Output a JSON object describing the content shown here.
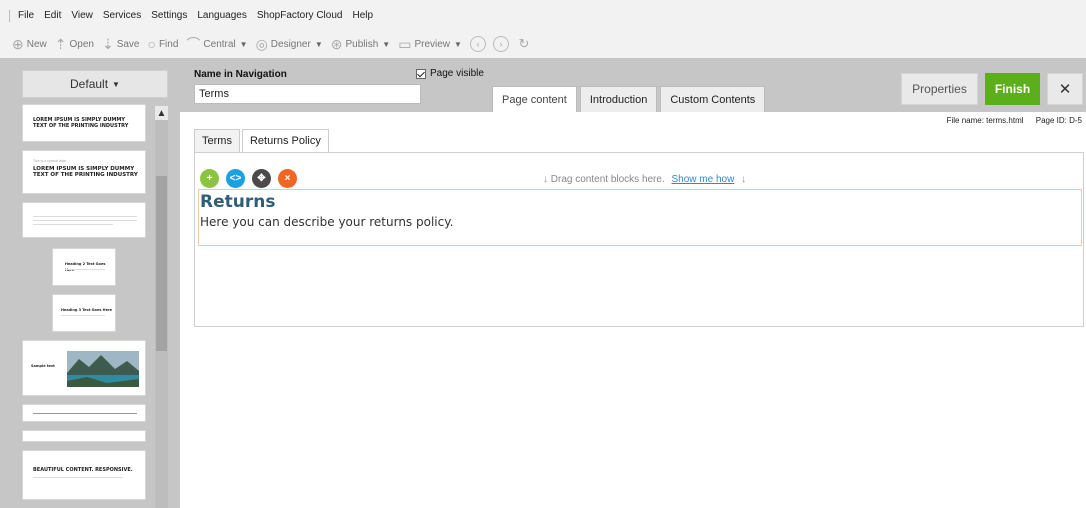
{
  "menu": [
    "File",
    "Edit",
    "View",
    "Services",
    "Settings",
    "Languages",
    "ShopFactory Cloud",
    "Help"
  ],
  "toolbar": {
    "new": "New",
    "open": "Open",
    "save": "Save",
    "find": "Find",
    "central": "Central",
    "designer": "Designer",
    "publish": "Publish",
    "preview": "Preview"
  },
  "left_panel": {
    "default_label": "Default",
    "thumbs": [
      {
        "title": "LOREM IPSUM IS SIMPLY DUMMY TEXT OF THE PRINTING INDUSTRY"
      },
      {
        "small": "This is a special label",
        "title": "LOREM IPSUM IS SIMPLY DUMMY TEXT OF THE PRINTING INDUSTRY"
      },
      {
        "title": ""
      },
      {
        "title": "Heading 2 Text Goes Here"
      },
      {
        "title": "Heading 3 Text Goes Here"
      },
      {
        "title": "Sample text"
      },
      {
        "title": ""
      },
      {
        "title": ""
      },
      {
        "title": "BEAUTIFUL CONTENT. RESPONSIVE."
      }
    ]
  },
  "header": {
    "nav_label": "Name in Navigation",
    "nav_value": "Terms",
    "page_visible": "Page visible",
    "tabs": [
      "Page content",
      "Introduction",
      "Custom Contents"
    ],
    "properties": "Properties",
    "finish": "Finish",
    "close": "✕"
  },
  "main": {
    "file_name": "File name: terms.html",
    "page_id": "Page ID: D-5",
    "subtabs": [
      "Terms",
      "Returns Policy"
    ],
    "drag_hint": "Drag content blocks here.",
    "show_me_how": "Show me how",
    "block_title": "Returns",
    "block_text": "Here you can describe your returns policy."
  },
  "colors": {
    "finish": "#5caf1c",
    "tool_add": "#8bc53f",
    "tool_code": "#1ba1e2",
    "tool_move": "#4a4a4a",
    "tool_delete": "#f26522",
    "title": "#2f5e78"
  }
}
